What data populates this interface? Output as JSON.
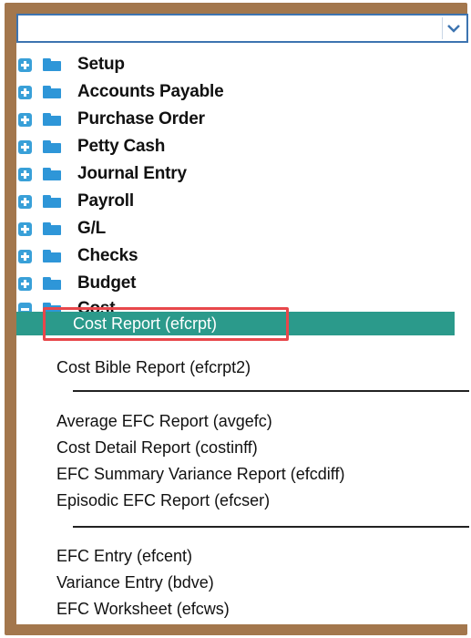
{
  "dropdown": {
    "value": "",
    "icon": "chevron-down-icon",
    "border_color": "#3d74b0"
  },
  "tree": {
    "nodes": [
      {
        "label": "Setup",
        "state": "collapsed"
      },
      {
        "label": "Accounts Payable",
        "state": "collapsed"
      },
      {
        "label": "Purchase Order",
        "state": "collapsed"
      },
      {
        "label": "Petty Cash",
        "state": "collapsed"
      },
      {
        "label": "Journal Entry",
        "state": "collapsed"
      },
      {
        "label": "Payroll",
        "state": "collapsed"
      },
      {
        "label": "G/L",
        "state": "collapsed"
      },
      {
        "label": "Checks",
        "state": "collapsed"
      },
      {
        "label": "Budget",
        "state": "collapsed"
      },
      {
        "label": "Cost",
        "state": "expanded"
      }
    ],
    "cost_children": {
      "group1": [
        "Cost Report (efcrpt)",
        "Cost Bible Report (efcrpt2)"
      ],
      "group2": [
        "Average EFC Report (avgefc)",
        "Cost Detail Report (costinff)",
        "EFC Summary Variance Report (efcdiff)",
        "Episodic EFC Report (efcser)"
      ],
      "group3": [
        "EFC Entry (efcent)",
        "Variance Entry (bdve)",
        "EFC Worksheet (efcws)"
      ]
    },
    "selected": "Cost Report (efcrpt)"
  },
  "colors": {
    "frame": "#a3774d",
    "folder": "#2e96d8",
    "expander": "#39a0d8",
    "selection": "#2b9a8b",
    "annotation": "#e8474b"
  }
}
